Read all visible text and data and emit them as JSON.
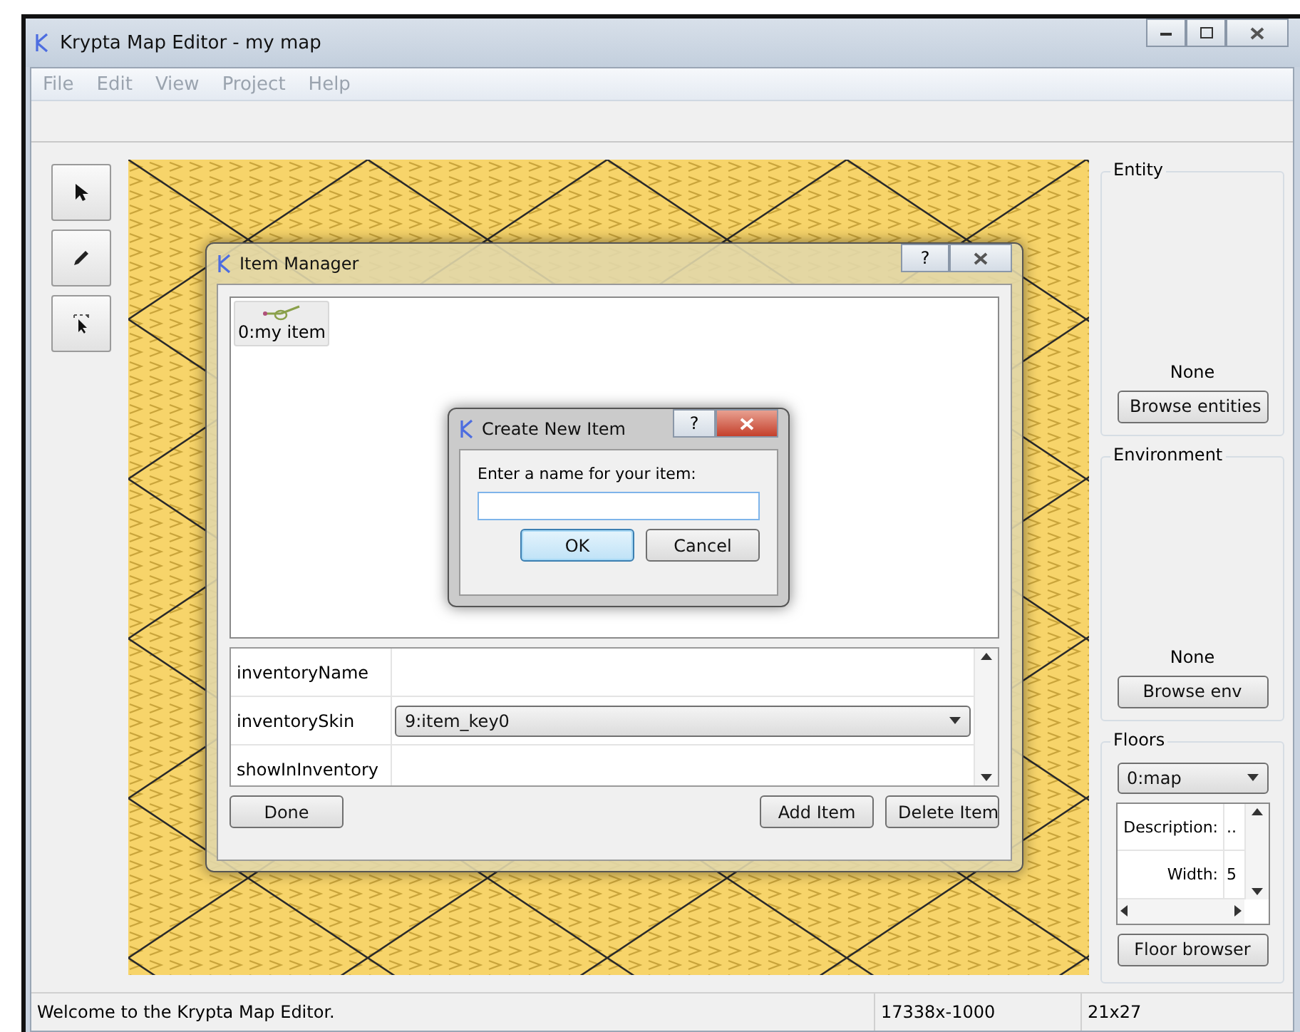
{
  "window": {
    "title": "Krypta Map Editor - my map"
  },
  "menu": [
    "File",
    "Edit",
    "View",
    "Project",
    "Help"
  ],
  "tools": [
    {
      "kind": "pointer"
    },
    {
      "kind": "pencil"
    },
    {
      "kind": "select"
    }
  ],
  "item_manager": {
    "title": "Item Manager",
    "help": "?",
    "items": [
      {
        "label": "0:my item",
        "selected": true
      }
    ],
    "properties": [
      {
        "kind": "text",
        "name": "inventoryName"
      },
      {
        "kind": "combo",
        "name": "inventorySkin",
        "value": "9:item_key0"
      },
      {
        "kind": "text",
        "name": "showInInventory"
      }
    ],
    "buttons_left": [
      "Done"
    ],
    "buttons_right": [
      "Add Item",
      "Delete Item"
    ]
  },
  "create_item": {
    "title": "Create New Item",
    "help": "?",
    "prompt": "Enter a name for your item:",
    "buttons": [
      {
        "label": "OK",
        "default": true
      },
      {
        "label": "Cancel",
        "default": false
      }
    ]
  },
  "entity": {
    "title": "Entity",
    "value": "None",
    "button": "Browse entities"
  },
  "environment": {
    "title": "Environment",
    "value": "None",
    "button": "Browse env"
  },
  "floors": {
    "title": "Floors",
    "floor": "0:map",
    "properties": [
      {
        "label": "Description:",
        "value": ".."
      },
      {
        "label": "Width:",
        "value": "5"
      }
    ],
    "button": "Floor browser"
  },
  "status_bar": {
    "message": "Welcome to the Krypta Map Editor.",
    "position": "17338x-1000",
    "size": "21x27"
  }
}
